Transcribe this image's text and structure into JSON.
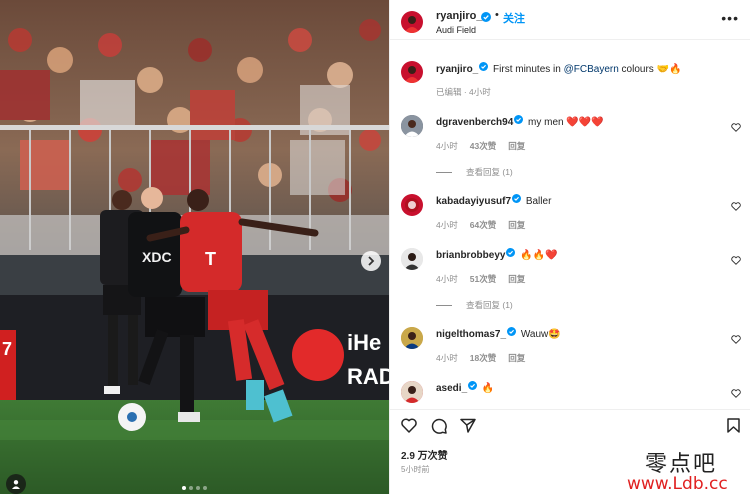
{
  "post": {
    "username": "ryanjiro_",
    "follow_label": "关注",
    "location": "Audi Field",
    "separator": "•"
  },
  "caption": {
    "username": "ryanjiro_",
    "text_before": "First minutes in ",
    "mention": "@FCBayern",
    "text_after": " colours 🤝🔥",
    "status": "已编辑 · 4小时"
  },
  "comments": [
    {
      "username": "dgravenberch94",
      "text": "my men ❤️❤️❤️",
      "time": "4小时",
      "likes": "43次赞",
      "reply": "回复",
      "verified": true,
      "view_replies": "查看回复 (1)"
    },
    {
      "username": "kabadayiyusuf7",
      "text": "Baller",
      "time": "4小时",
      "likes": "64次赞",
      "reply": "回复",
      "verified": true
    },
    {
      "username": "brianbrobbeyy",
      "text": "🔥🔥❤️",
      "time": "4小时",
      "likes": "51次赞",
      "reply": "回复",
      "verified": true,
      "view_replies": "查看回复 (1)"
    },
    {
      "username": "nigelthomas7_",
      "text": "Wauw🤩",
      "time": "4小时",
      "likes": "18次赞",
      "reply": "回复",
      "verified": true
    },
    {
      "username": "asedi_",
      "text": "🔥",
      "verified": true
    }
  ],
  "stats": {
    "likes": "2.9 万次赞",
    "ago": "5小时前"
  },
  "photo": {
    "jersey_sponsor": "T",
    "opponent_sponsor": "XDC",
    "board_text_1": "iHe",
    "board_text_2": "RAD",
    "board_left": "7"
  },
  "watermark": {
    "line1": "零点吧",
    "line2": "www.Ldb.cc"
  },
  "colors": {
    "accent": "#0095f6",
    "bayern_red": "#c8102e",
    "verified": "#0095f6",
    "heart": "#ed4956"
  },
  "icons": [
    "next-arrow-icon",
    "user-tag-icon",
    "more-options-icon",
    "verified-badge-icon",
    "heart-icon",
    "like-icon",
    "comment-icon",
    "share-icon",
    "save-icon"
  ]
}
